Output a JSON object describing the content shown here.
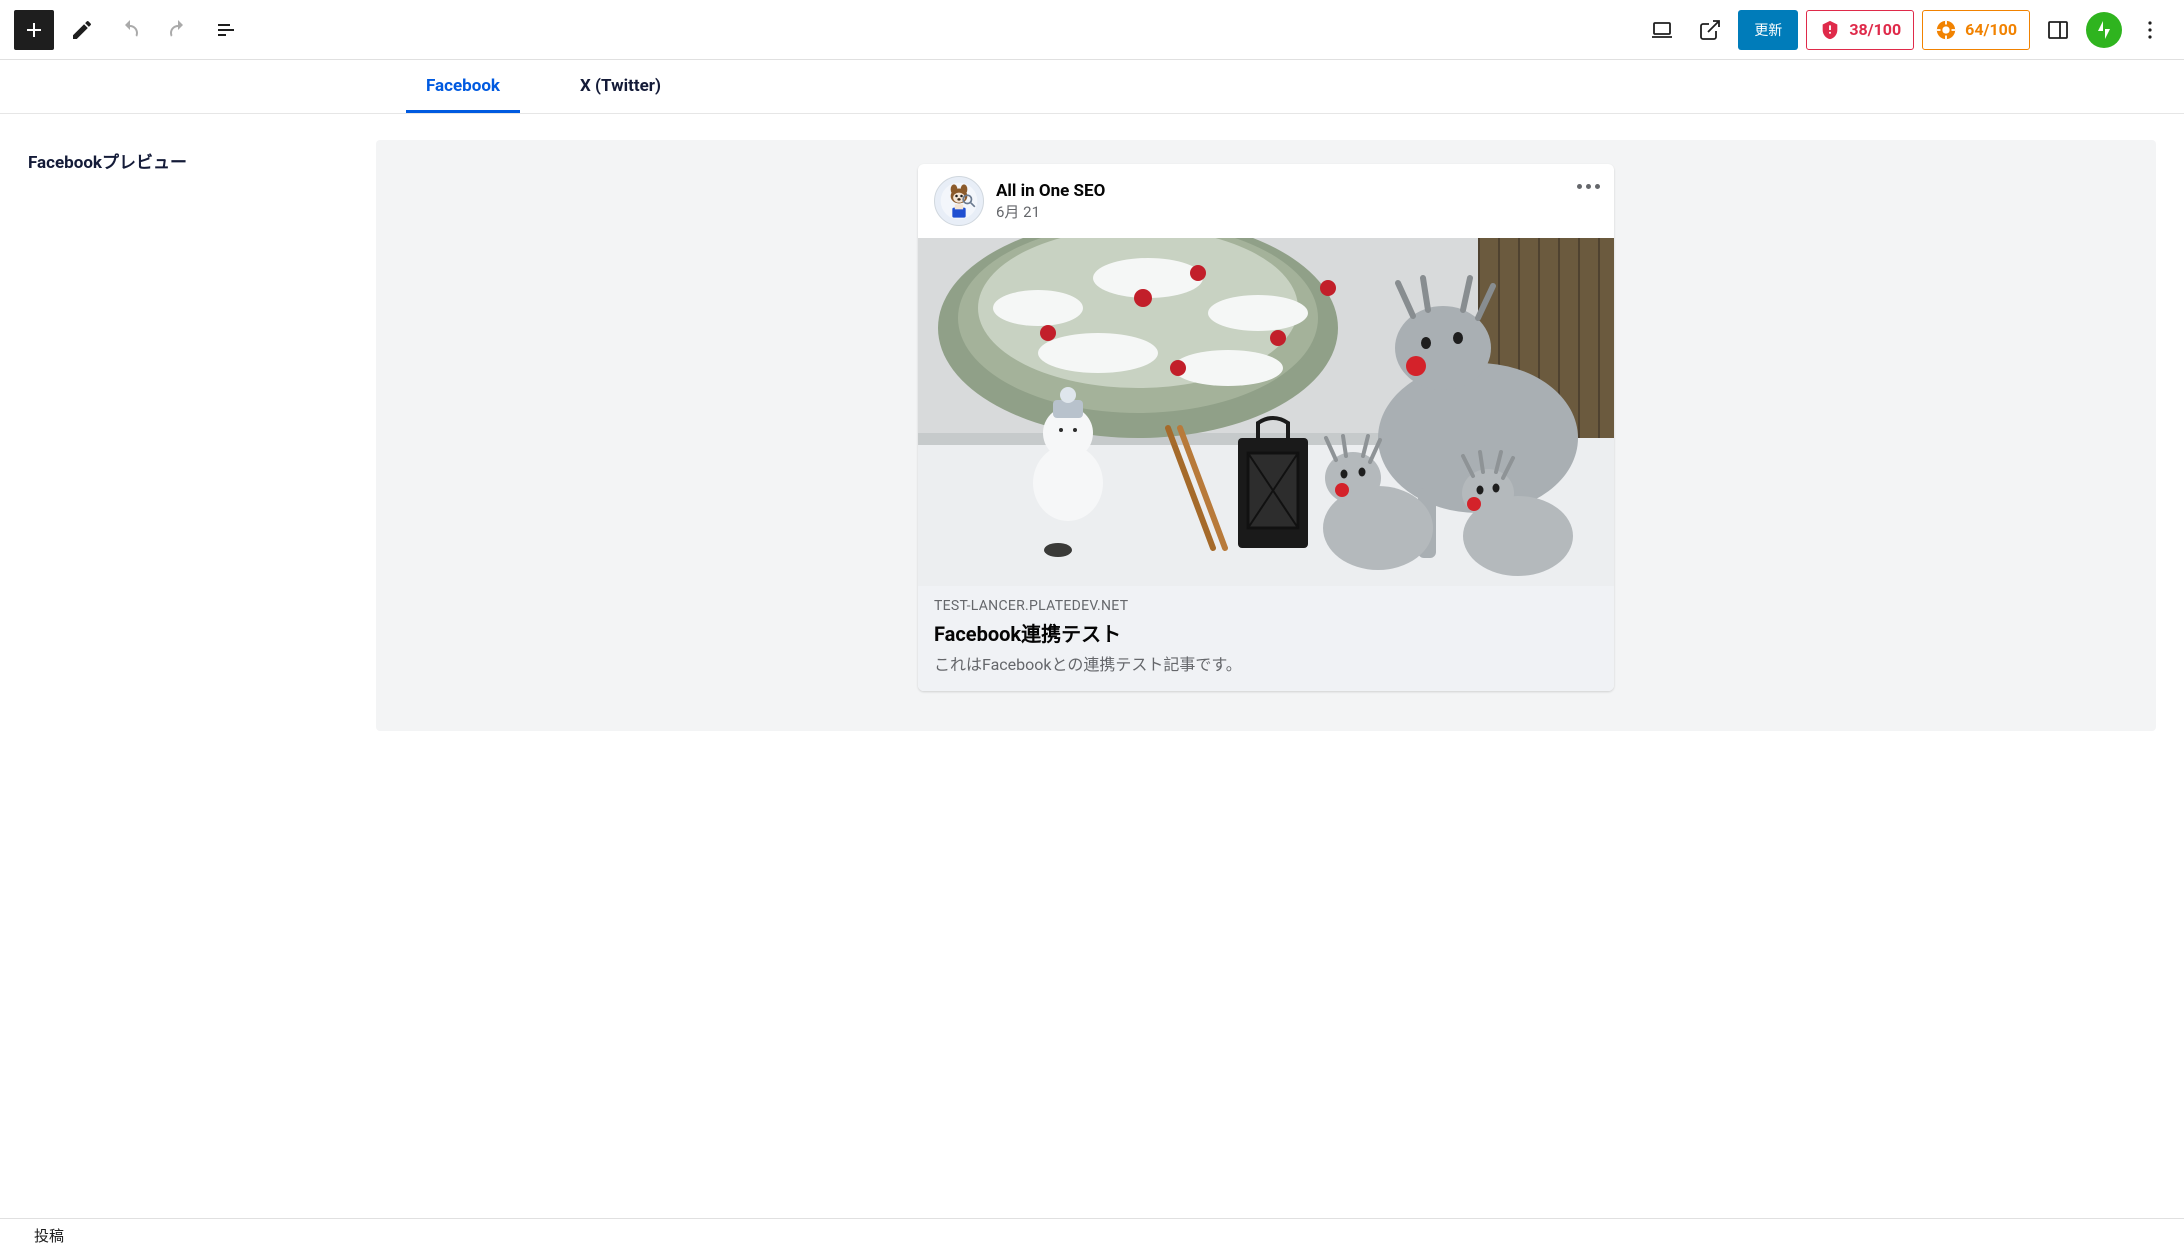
{
  "toolbar": {
    "update_label": "更新",
    "score_red": "38/100",
    "score_orange": "64/100"
  },
  "tabs": {
    "facebook": "Facebook",
    "twitter": "X (Twitter)"
  },
  "side_label": "Facebookプレビュー",
  "fb_preview": {
    "author": "All in One SEO",
    "date": "6月 21",
    "domain": "TEST-LANCER.PLATEDEV.NET",
    "title": "Facebook連携テスト",
    "description": "これはFacebookとの連携テスト記事です。"
  },
  "footer": {
    "label": "投稿"
  }
}
